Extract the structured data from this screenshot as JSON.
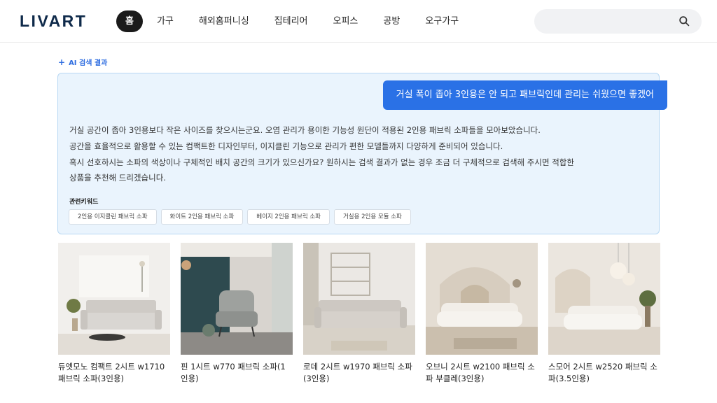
{
  "header": {
    "logo": "LIVART",
    "nav": [
      "홈",
      "가구",
      "해외홈퍼니싱",
      "집테리어",
      "오피스",
      "공방",
      "오구가구"
    ],
    "active_nav": "홈",
    "search": {
      "placeholder": "",
      "icon": "search-icon"
    }
  },
  "ai_result": {
    "label": "AI 검색 결과",
    "query": "거실 폭이 좁아 3인용은 안 되고 패브릭인데 관리는 쉬웠으면 좋겠어",
    "answer_lines": [
      "거실 공간이 좁아 3인용보다 작은 사이즈를 찾으시는군요. 오염 관리가 용이한 기능성 원단이 적용된 2인용 패브릭 소파들을 모아보았습니다.",
      "공간을 효율적으로 활용할 수 있는 컴팩트한 디자인부터, 이지클린 기능으로 관리가 편한 모델들까지 다양하게 준비되어 있습니다.",
      "혹시 선호하시는 소파의 색상이나 구체적인 배치 공간의 크기가 있으신가요? 원하시는 검색 결과가 없는 경우 조금 더 구체적으로 검색해 주시면 적합한",
      "상품을 추천해 드리겠습니다."
    ],
    "keywords_title": "관련키워드",
    "keywords": [
      "2인용 이지클린 패브릭 소파",
      "화이트 2인용 패브릭 소파",
      "베이지 2인용 패브릭 소파",
      "거실용 2인용 모듈 소파"
    ]
  },
  "products": [
    {
      "name": "듀엣모노 컴팩트 2시트 w1710 패브릭 소파(3인용)"
    },
    {
      "name": "핀 1시트 w770 패브릭 소파(1인용)"
    },
    {
      "name": "로데 2시트 w1970 패브릭 소파(3인용)"
    },
    {
      "name": "오브니 2시트 w2100 패브릭 소파 부클레(3인용)"
    },
    {
      "name": "스모어 2시트 w2520 패브릭 소파(3.5인용)"
    }
  ],
  "colors": {
    "accent": "#2a71e6",
    "panel_bg": "#eaf4fd",
    "panel_border": "#b8d8f3",
    "logo": "#0f2a4a"
  }
}
